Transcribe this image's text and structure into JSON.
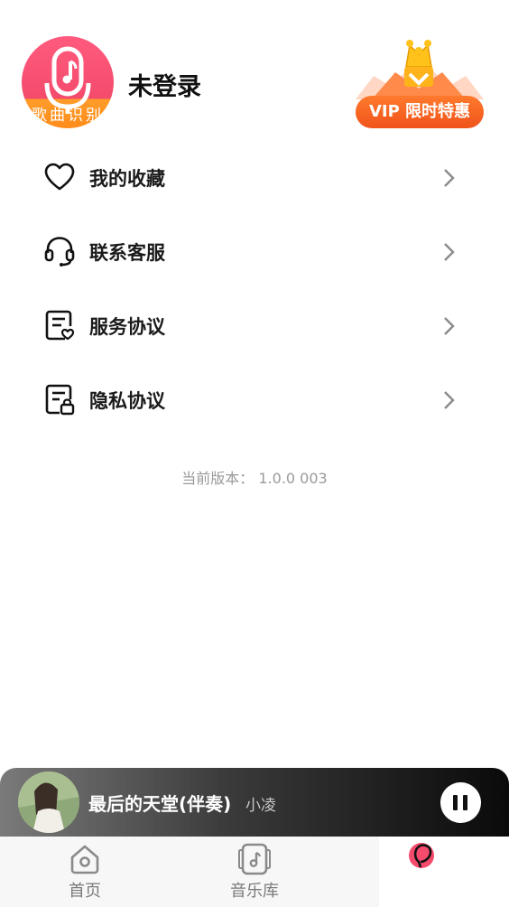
{
  "header": {
    "logo_text": "歌曲识别",
    "login_status": "未登录",
    "vip_label": "VIP 限时特惠"
  },
  "menu": {
    "items": [
      {
        "label": "我的收藏",
        "icon": "heart-icon"
      },
      {
        "label": "联系客服",
        "icon": "headset-icon"
      },
      {
        "label": "服务协议",
        "icon": "agreement-icon"
      },
      {
        "label": "隐私协议",
        "icon": "privacy-icon"
      }
    ]
  },
  "version": "当前版本：  1.0.0 003",
  "player": {
    "title": "最后的天堂(伴奏)",
    "artist": "小凌",
    "state": "playing"
  },
  "nav": {
    "items": [
      {
        "label": "首页",
        "icon": "home-icon"
      },
      {
        "label": "音乐库",
        "icon": "music-library-icon"
      },
      {
        "label": "",
        "icon": "profile-icon"
      }
    ]
  },
  "colors": {
    "accent": "#f44b6c",
    "vip_orange": "#f0531a",
    "text_dark": "#1a1a1a",
    "muted": "#9a9a9a"
  }
}
